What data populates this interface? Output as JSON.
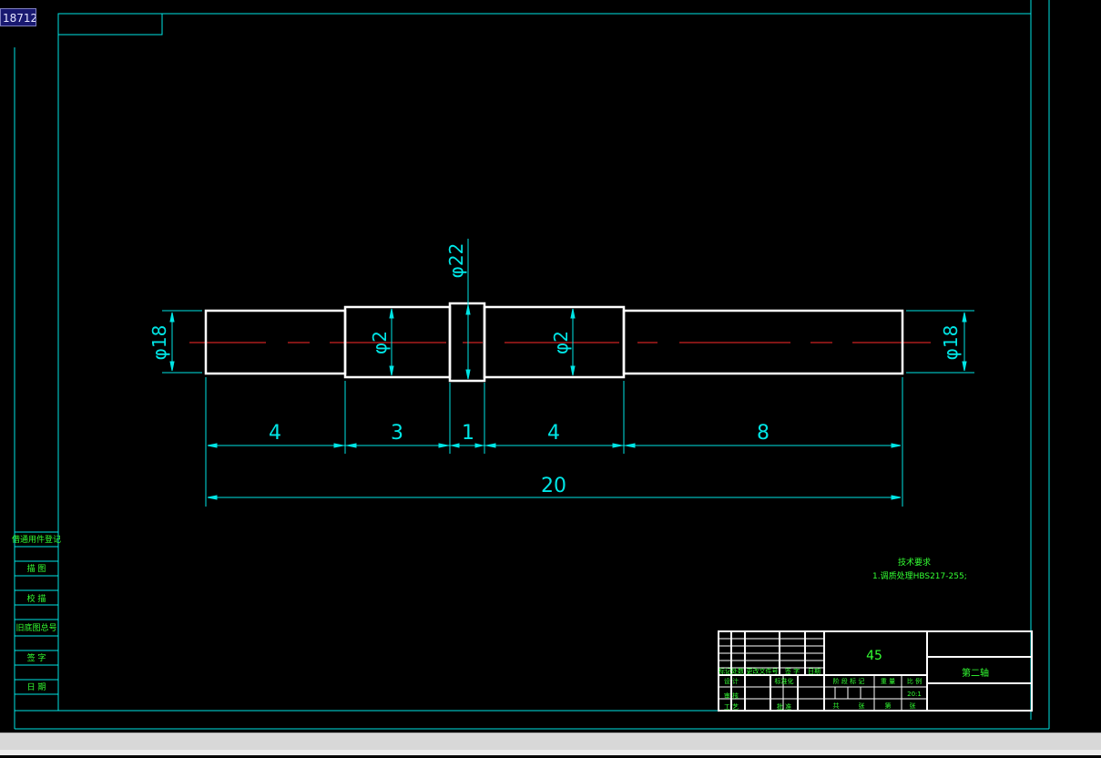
{
  "app": {
    "coord_readout": "18712"
  },
  "colors": {
    "background": "#000000",
    "frame": "#00e5e5",
    "part": "#ffffff",
    "centerline": "#ff2a2a",
    "dimension": "#00e5e5",
    "annotation": "#33ff33",
    "badge_bg": "#191970"
  },
  "drawing": {
    "diameters": {
      "left_end": "φ18",
      "left_step": "φ2",
      "collar": "φ22",
      "right_step": "φ2",
      "right_end": "φ18"
    },
    "lengths": [
      "4",
      "3",
      "1",
      "4",
      "8"
    ],
    "overall_length": "20",
    "tech_requirements": {
      "heading": "技术要求",
      "line1": "1.调质处理HBS217-255;"
    }
  },
  "side_block": {
    "rows": [
      "借通用件登记",
      "描 图",
      "校 描",
      "旧底图总号",
      "签 字",
      "日 期"
    ]
  },
  "title_block": {
    "material": "45",
    "part_name": "第二轴",
    "scale": "20:1",
    "stage_header": "阶 段 标 记",
    "weight_header": "重 量",
    "scale_header": "比 例",
    "sheet_label_a": "共",
    "sheet_label_b": "张",
    "sheet_label_c": "第",
    "sheet_label_d": "张",
    "rev_cols": [
      "标记",
      "处数",
      "更改文件号",
      "签 字",
      "日期"
    ],
    "role_rows": [
      "设 计",
      "审 核",
      "工 艺"
    ],
    "std_label": "标准化",
    "approve_label": "批 准"
  }
}
